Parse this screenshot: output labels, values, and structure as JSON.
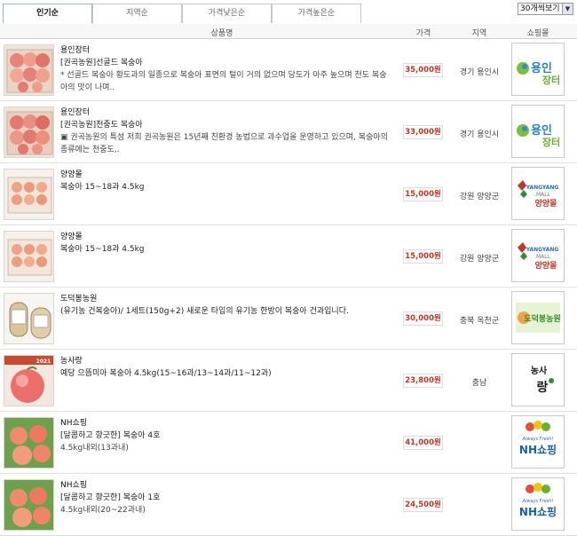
{
  "tabs": [
    {
      "label": "인기순",
      "active": true
    },
    {
      "label": "지역순",
      "active": false
    },
    {
      "label": "가격낮은순",
      "active": false
    },
    {
      "label": "가격높은순",
      "active": false
    }
  ],
  "per_page": {
    "selected": "30개씩보기"
  },
  "columns": {
    "product": "상품명",
    "price": "가격",
    "region": "지역",
    "mall": "쇼핑몰"
  },
  "products": [
    {
      "seller": "용인장터",
      "title": "[권곡농원]선골드 복숭아",
      "desc": "* 선골드 복숭아 황도과의 일종으로 복숭아 표면의 털이 거의 없으며 당도가 아주 높으며 천도 복숭아의 맛이 나며..",
      "price": "35,000원",
      "region": "경기 용인시",
      "mall": "용인장터"
    },
    {
      "seller": "용인장터",
      "title": "[권곡농원]천중도 복숭아",
      "desc": "▣ 권곡농원의 특성 저희 권곡농원은 15년째 친환경 농법으로 과수업을 운영하고 있으며, 복숭아의 종류에는 천중도,.",
      "price": "33,000원",
      "region": "경기 용인시",
      "mall": "용인장터"
    },
    {
      "seller": "양양몰",
      "title": "복숭아 15~18과 4.5kg",
      "desc": "",
      "price": "15,000원",
      "region": "강원 양양군",
      "mall": "YANGYANG.MALL 양양몰"
    },
    {
      "seller": "양양몰",
      "title": "복숭아 15~18과 4.5kg",
      "desc": "",
      "price": "15,000원",
      "region": "강원 양양군",
      "mall": "YANGYANG.MALL 양양몰"
    },
    {
      "seller": "도덕봉농원",
      "title": "(유기농 건복숭아)/ 1세트(150g+2) 새로운 타입의 유기농 한방이 복숭아 건과입니다.",
      "desc": "",
      "price": "30,000원",
      "region": "충북 옥천군",
      "mall": "도덕봉농원"
    },
    {
      "seller": "농사랑",
      "title": "예당 으뜸미아 복숭아 4.5kg(15~16과/13~14과/11~12과)",
      "desc": "",
      "price": "23,800원",
      "region": "충남",
      "mall": "농사랑"
    },
    {
      "seller": "NH쇼핑",
      "title": "[달콤하고 향긋한] 복숭아 4호",
      "desc": "4.5kg내외(13과내)",
      "price": "41,000원",
      "region": "",
      "mall": "Always Fresh! NH쇼핑"
    },
    {
      "seller": "NH쇼핑",
      "title": "[달콤하고 향긋한] 복숭아 1호",
      "desc": "4.5kg내외(20~22과내)",
      "price": "24,500원",
      "region": "",
      "mall": "Always Fresh! NH쇼핑"
    }
  ]
}
